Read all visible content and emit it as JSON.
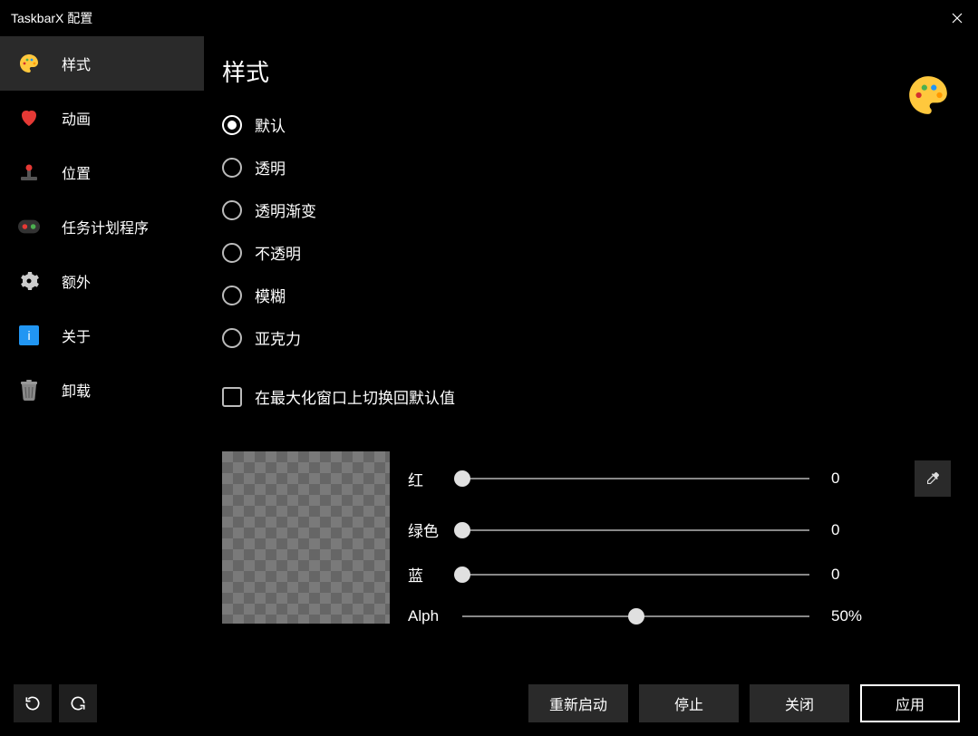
{
  "window": {
    "title": "TaskbarX 配置"
  },
  "sidebar": {
    "items": [
      {
        "label": "样式",
        "icon": "palette",
        "active": true
      },
      {
        "label": "动画",
        "icon": "heart"
      },
      {
        "label": "位置",
        "icon": "joystick"
      },
      {
        "label": "任务计划程序",
        "icon": "scheduler"
      },
      {
        "label": "额外",
        "icon": "gear"
      },
      {
        "label": "关于",
        "icon": "info"
      },
      {
        "label": "卸载",
        "icon": "trash"
      }
    ]
  },
  "page": {
    "title": "样式"
  },
  "radios": {
    "options": [
      {
        "label": "默认",
        "selected": true
      },
      {
        "label": "透明",
        "selected": false
      },
      {
        "label": "透明渐变",
        "selected": false
      },
      {
        "label": "不透明",
        "selected": false
      },
      {
        "label": "模糊",
        "selected": false
      },
      {
        "label": "亚克力",
        "selected": false
      }
    ]
  },
  "checkbox": {
    "label": "在最大化窗口上切换回默认值"
  },
  "sliders": {
    "red": {
      "label": "红",
      "value": "0",
      "percent": 0
    },
    "green": {
      "label": "绿色",
      "value": "0",
      "percent": 0
    },
    "blue": {
      "label": "蓝",
      "value": "0",
      "percent": 0
    },
    "alpha": {
      "label": "Alph",
      "value": "50%",
      "percent": 50
    }
  },
  "footer": {
    "restart": "重新启动",
    "stop": "停止",
    "close": "关闭",
    "apply": "应用"
  }
}
